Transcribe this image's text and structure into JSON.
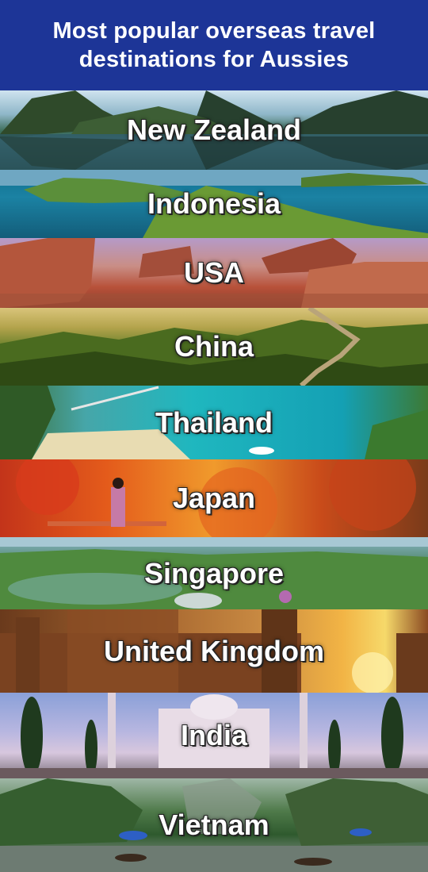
{
  "header": {
    "title_line1": "Most popular overseas travel",
    "title_line2": "destinations for Aussies",
    "background_color": "#1d3597"
  },
  "destinations": [
    {
      "name": "New Zealand"
    },
    {
      "name": "Indonesia"
    },
    {
      "name": "USA"
    },
    {
      "name": "China"
    },
    {
      "name": "Thailand"
    },
    {
      "name": "Japan"
    },
    {
      "name": "Singapore"
    },
    {
      "name": "United Kingdom"
    },
    {
      "name": "India"
    },
    {
      "name": "Vietnam"
    }
  ]
}
